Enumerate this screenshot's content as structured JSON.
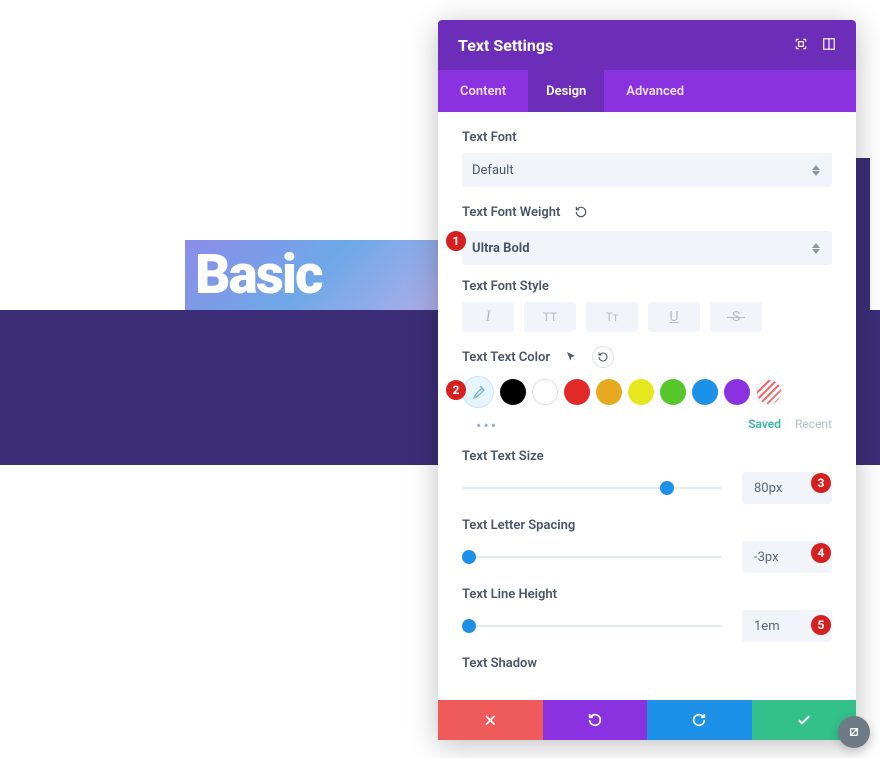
{
  "background": {
    "basic_text": "Basic"
  },
  "panel": {
    "title": "Text Settings",
    "tabs": {
      "content": "Content",
      "design": "Design",
      "advanced": "Advanced"
    },
    "active_tab": "design"
  },
  "fields": {
    "font": {
      "label": "Text Font",
      "value": "Default"
    },
    "font_weight": {
      "label": "Text Font Weight",
      "value": "Ultra Bold"
    },
    "font_style": {
      "label": "Text Font Style",
      "buttons": {
        "italic": "I",
        "uppercase": "TT",
        "small_caps": "Tᴛ",
        "underline": "U",
        "strike": "S"
      }
    },
    "text_color": {
      "label": "Text Text Color",
      "swatches": [
        {
          "name": "picker",
          "color": "picker"
        },
        {
          "name": "black",
          "color": "#000000"
        },
        {
          "name": "white",
          "color": "#ffffff"
        },
        {
          "name": "red",
          "color": "#e12929"
        },
        {
          "name": "orange",
          "color": "#e7a91e"
        },
        {
          "name": "yellow",
          "color": "#e7e71e"
        },
        {
          "name": "green",
          "color": "#57c82b"
        },
        {
          "name": "blue",
          "color": "#1d90e8"
        },
        {
          "name": "purple",
          "color": "#8b32e0"
        },
        {
          "name": "none",
          "color": "striped"
        }
      ],
      "saved": "Saved",
      "recent": "Recent"
    },
    "text_size": {
      "label": "Text Text Size",
      "value": "80px",
      "handle_pct": 76
    },
    "letter_spacing": {
      "label": "Text Letter Spacing",
      "value": "-3px",
      "handle_pct": 0
    },
    "line_height": {
      "label": "Text Line Height",
      "value": "1em",
      "handle_pct": 0
    },
    "text_shadow": {
      "label": "Text Shadow"
    }
  },
  "markers": {
    "m1": "1",
    "m2": "2",
    "m3": "3",
    "m4": "4",
    "m5": "5"
  }
}
